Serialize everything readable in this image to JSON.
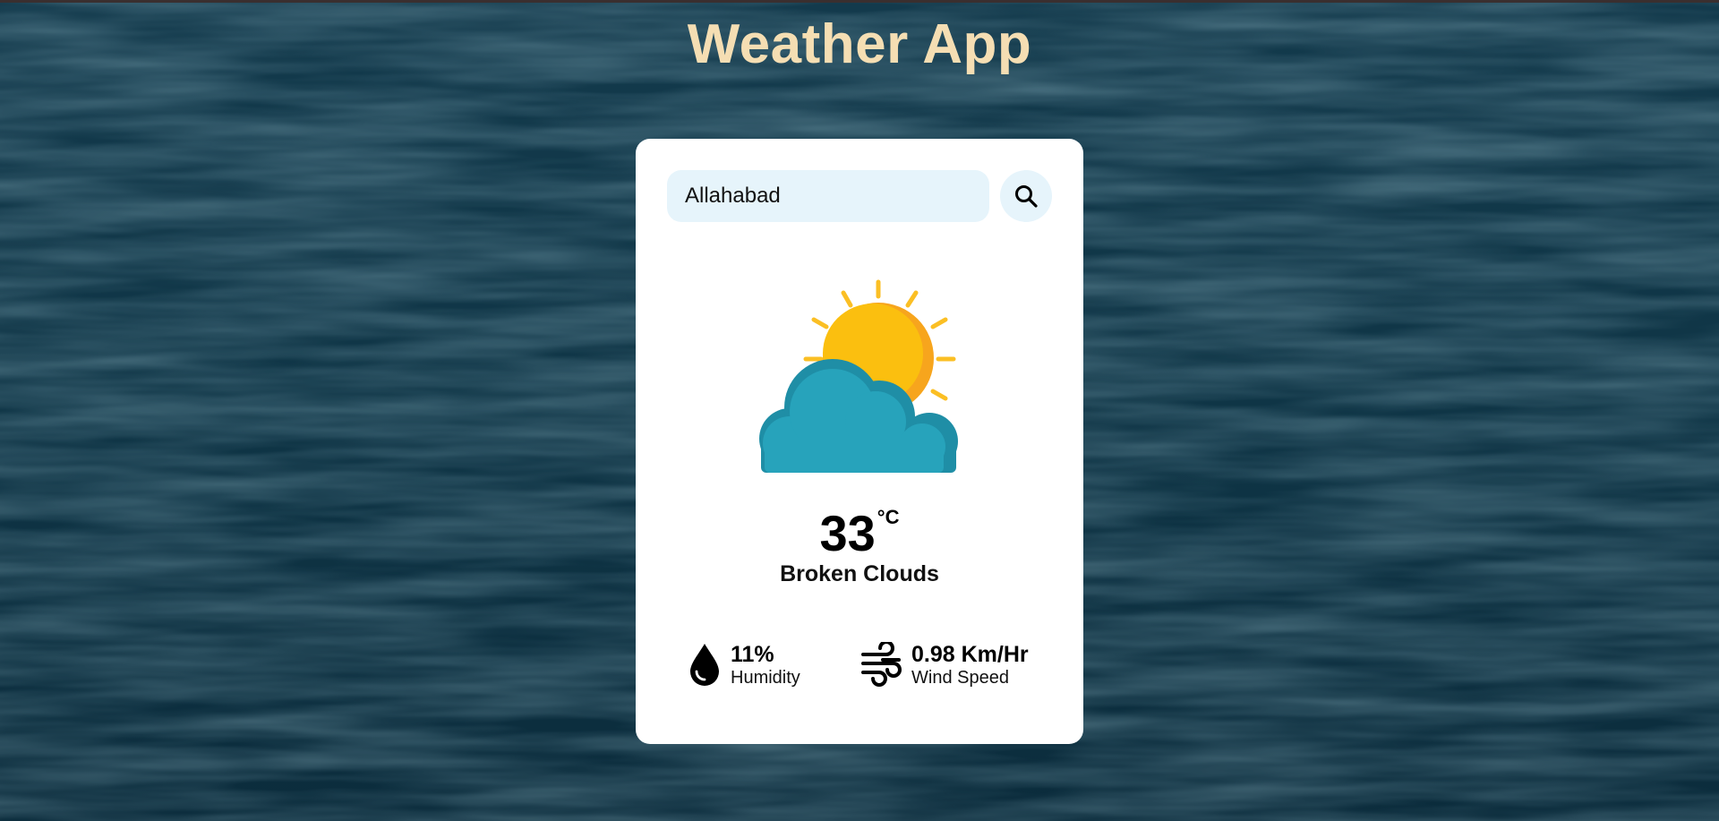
{
  "app": {
    "title": "Weather App"
  },
  "search": {
    "value": "Allahabad"
  },
  "weather": {
    "icon": "sun-behind-cloud-icon",
    "temperature": "33",
    "unit": "°C",
    "description": "Broken Clouds"
  },
  "humidity": {
    "value": "11%",
    "label": "Humidity",
    "icon": "water-drop-icon"
  },
  "wind": {
    "value": "0.98 Km/Hr",
    "label": "Wind Speed",
    "icon": "wind-icon"
  },
  "colors": {
    "title": "#f5deb3",
    "card": "#ffffff",
    "input_bg": "#e6f4fb",
    "sun": "#fbbf0f",
    "cloud": "#27a3bb",
    "water": "#0f3a4d"
  }
}
